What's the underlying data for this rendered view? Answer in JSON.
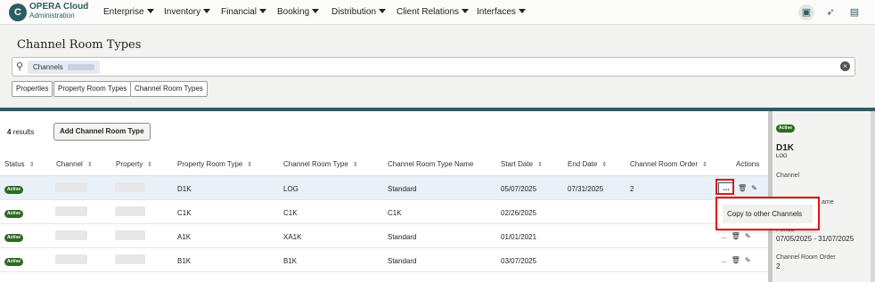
{
  "app": {
    "brand_line1": "OPERA Cloud",
    "brand_line2": "Administration",
    "logo_letter": "C"
  },
  "nav": [
    "Enterprise",
    "Inventory",
    "Financial",
    "Booking",
    "Distribution",
    "Client Relations",
    "Interfaces"
  ],
  "page": {
    "title": "Channel Room Types"
  },
  "search": {
    "chip_label": "Channels"
  },
  "filters": [
    "Properties",
    "Property Room Types",
    "Channel Room Types"
  ],
  "results": {
    "count": "4",
    "label": "results",
    "add_button": "Add Channel Room Type"
  },
  "columns": [
    "Status",
    "Channel",
    "Property",
    "Property Room Type",
    "Channel Room Type",
    "Channel Room Type Name",
    "Start Date",
    "End Date",
    "Channel Room Order",
    "Actions"
  ],
  "rows": [
    {
      "status": "Active",
      "property_room_type": "D1K",
      "channel_room_type": "LOG",
      "name": "Standard",
      "start": "05/07/2025",
      "end": "07/31/2025",
      "order": "2"
    },
    {
      "status": "Active",
      "property_room_type": "C1K",
      "channel_room_type": "C1K",
      "name": "C1K",
      "start": "02/26/2025",
      "end": "",
      "order": ""
    },
    {
      "status": "Active",
      "property_room_type": "A1K",
      "channel_room_type": "XA1K",
      "name": "Standard",
      "start": "01/01/2021",
      "end": "",
      "order": ""
    },
    {
      "status": "Active",
      "property_room_type": "B1K",
      "channel_room_type": "B1K",
      "name": "Standard",
      "start": "03/07/2025",
      "end": "",
      "order": ""
    }
  ],
  "actions": {
    "more": "...",
    "menu_option": "Copy to other Channels"
  },
  "detail": {
    "status": "Active",
    "title": "D1K",
    "subtitle": "LOG",
    "channel_label": "Channel",
    "name_label_fragment": "ame",
    "period_label": "Period",
    "period_value": "07/05/2025 - 31/07/2025",
    "order_label": "Channel Room Order",
    "order_value": "2"
  },
  "colors": {
    "accent": "#2c5d63",
    "active_badge": "#2e6a22",
    "highlight": "#e0141b",
    "selected_row": "#e8f1f7"
  }
}
